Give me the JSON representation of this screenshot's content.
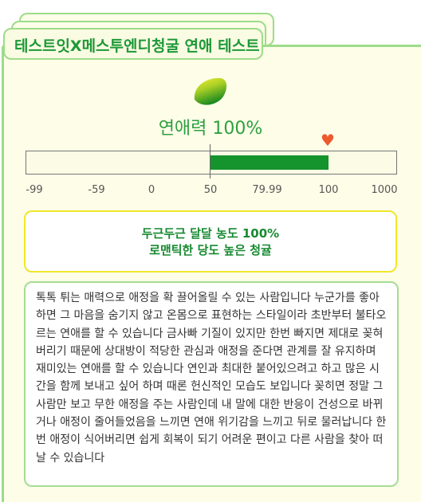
{
  "header": {
    "title": "테스트잇X메스투엔디청굴 연애 테스트"
  },
  "result": {
    "score_label": "연애력 100%",
    "score_value": 100,
    "summary_line1": "두근두근 달달 농도 100%",
    "summary_line2": "로맨틱한 당도 높은 청귤",
    "description": "톡톡 튀는 매력으로 애정을 확 끌어올릴 수 있는 사람입니다 누군가를 좋아하면 그 마음을 숨기지 않고 온몸으로 표현하는 스타일이라 초반부터 불타오르는 연애를 할 수 있습니다 금사빠 기질이 있지만 한번 빠지면 제대로 꽂혀버리기 때문에 상대방이 적당한 관심과 애정을 준다면 관계를 잘 유지하며 재미있는 연애를 할 수 있습니다 연인과 최대한 붙어있으려고 하고 많은 시간을 함께 보내고 싶어 하며 때론 헌신적인 모습도 보입니다 꽂히면 정말 그 사람만 보고 무한 애정을 주는 사람인데 내 말에 대한 반응이 건성으로 바뀌거나 애정이 줄어들었음을 느끼면 연애 위기감을 느끼고 뒤로 물러납니다 한번 애정이 식어버리면 쉽게 회복이 되기 어려운 편이고 다른 사람을 찾아 떠날 수 있습니다"
  },
  "gauge": {
    "ticks": [
      "-99",
      "-59",
      "0",
      "50",
      "79.99",
      "100",
      "1000"
    ],
    "fill_start": 50,
    "fill_end": 100,
    "marker": 100,
    "colors": {
      "fill": "#15932c",
      "marker": "#ec5a2e"
    }
  }
}
